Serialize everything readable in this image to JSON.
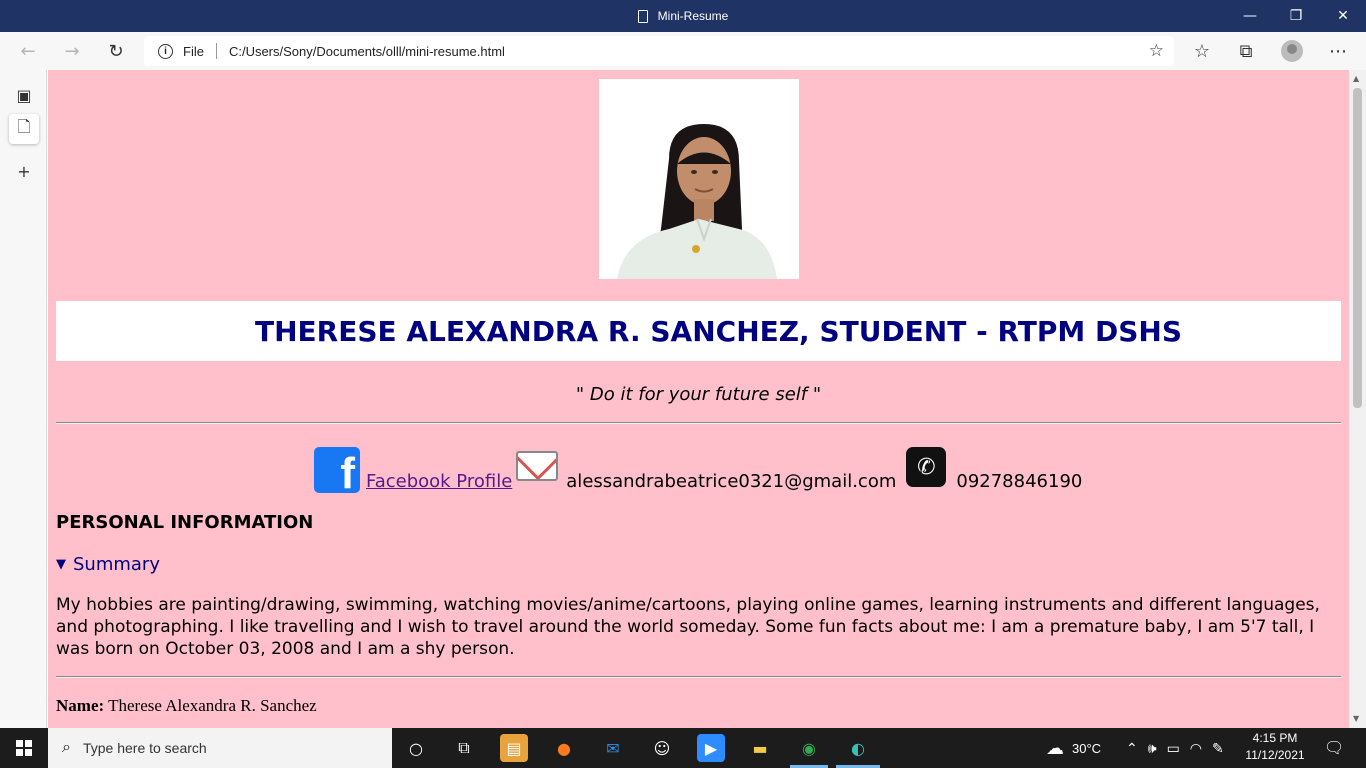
{
  "window": {
    "title": "Mini-Resume",
    "minimize_glyph": "—",
    "restore_glyph": "❐",
    "close_glyph": "✕"
  },
  "browser": {
    "address_scheme": "File",
    "address_url": "C:/Users/Sony/Documents/olll/mini-resume.html",
    "icons": [
      "back-icon",
      "forward-icon",
      "refresh-icon",
      "info-icon",
      "add-favorite-icon",
      "favorites-icon",
      "collections-icon",
      "profile-icon",
      "more-icon"
    ]
  },
  "resume": {
    "name_banner": "THERESE ALEXANDRA R. SANCHEZ, STUDENT - RTPM DSHS",
    "motto": "\" Do it for your future self \"",
    "facebook_label": "Facebook Profile ",
    "email": "alessandrabeatrice0321@gmail.com",
    "phone": "09278846190",
    "section_title": "PERSONAL INFORMATION",
    "summary_label": "Summary",
    "summary_text": "My hobbies are painting/drawing, swimming, watching movies/anime/cartoons, playing online games, learning instruments and different languages, and photographing. I like travelling and I wish to travel around the world someday. Some fun facts about me: I am a premature baby, I am 5'7 tall, I was born on October 03, 2008 and I am a shy person.",
    "name_label": "Name:",
    "name_value": " Therese Alexandra R. Sanchez"
  },
  "taskbar": {
    "search_placeholder": "Type here to search",
    "temperature": "30°C",
    "time": "4:15 PM",
    "date": "11/12/2021"
  },
  "colors": {
    "page_background": "#ffc0cb",
    "banner_text": "#000080",
    "titlebar": "#1f3364"
  }
}
